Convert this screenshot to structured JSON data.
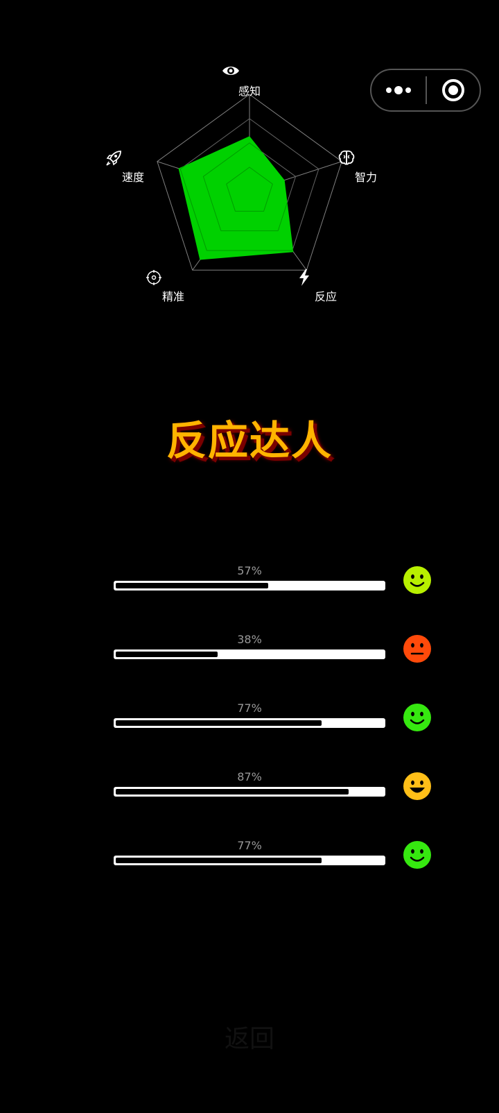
{
  "capsule": {
    "more_icon": "more-dots-icon",
    "close_icon": "target-close-icon"
  },
  "radar": {
    "axes": [
      {
        "label": "感知",
        "icon": "eye-icon",
        "value": 0.57
      },
      {
        "label": "智力",
        "icon": "brain-icon",
        "value": 0.38
      },
      {
        "label": "反应",
        "icon": "lightning-icon",
        "value": 0.77
      },
      {
        "label": "精准",
        "icon": "target-icon",
        "value": 0.87
      },
      {
        "label": "速度",
        "icon": "rocket-icon",
        "value": 0.77
      }
    ],
    "fill_color": "#00d100",
    "grid_color": "#808080"
  },
  "title": "反应达人",
  "stats": [
    {
      "percent_text": "57%",
      "value": 0.57,
      "face_color": "#b8f000",
      "face": "smile"
    },
    {
      "percent_text": "38%",
      "value": 0.38,
      "face_color": "#ff4a0a",
      "face": "neutral"
    },
    {
      "percent_text": "77%",
      "value": 0.77,
      "face_color": "#36e810",
      "face": "smile"
    },
    {
      "percent_text": "87%",
      "value": 0.87,
      "face_color": "#ffbf18",
      "face": "grin"
    },
    {
      "percent_text": "77%",
      "value": 0.77,
      "face_color": "#36e810",
      "face": "smile"
    }
  ],
  "back_label": "返回"
}
